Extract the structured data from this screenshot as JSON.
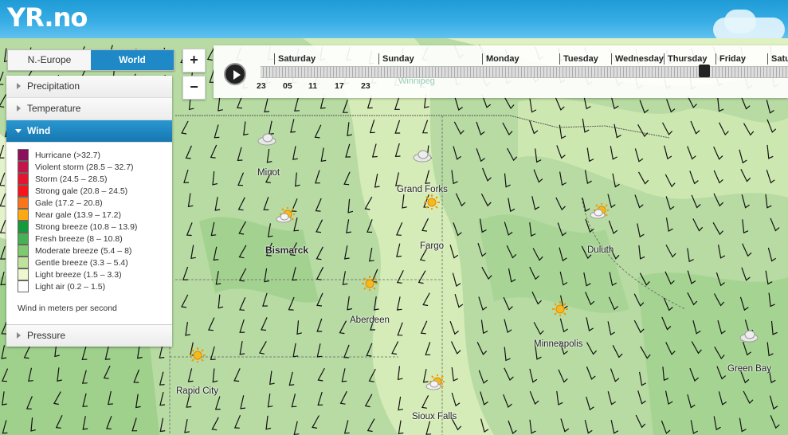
{
  "app": {
    "logo": "YR.no"
  },
  "region_toggle": {
    "left": "N.-Europe",
    "right": "World",
    "active": "World"
  },
  "zoom": {
    "in": "+",
    "out": "−"
  },
  "layers": {
    "precipitation": "Precipitation",
    "temperature": "Temperature",
    "wind": "Wind",
    "pressure": "Pressure"
  },
  "legend": {
    "items": [
      {
        "label": "Hurricane (>32.7)",
        "color": "#8b0f5b"
      },
      {
        "label": "Violent storm (28.5 – 32.7)",
        "color": "#c2154a"
      },
      {
        "label": "Storm (24.5 – 28.5)",
        "color": "#e4162f"
      },
      {
        "label": "Strong gale (20.8 – 24.5)",
        "color": "#f5151c"
      },
      {
        "label": "Gale (17.2 – 20.8)",
        "color": "#f9751c"
      },
      {
        "label": "Near gale (13.9 – 17.2)",
        "color": "#fbaa0f"
      },
      {
        "label": "Strong breeze (10.8 – 13.9)",
        "color": "#139b3b"
      },
      {
        "label": "Fresh breeze (8 – 10.8)",
        "color": "#47b253"
      },
      {
        "label": "Moderate breeze (5.4 – 8)",
        "color": "#7fca6e"
      },
      {
        "label": "Gentle breeze (3.3 – 5.4)",
        "color": "#c0e39c"
      },
      {
        "label": "Light breeze (1.5 – 3.3)",
        "color": "#eef8cf"
      },
      {
        "label": "Light air (0.2 – 1.5)",
        "color": "#ffffff"
      }
    ],
    "unit_note": "Wind in meters per second"
  },
  "timeline": {
    "days": [
      "Saturday",
      "Sunday",
      "Monday",
      "Tuesday",
      "Wednesday",
      "Thursday",
      "Friday",
      "Satu"
    ],
    "hours": [
      "23",
      "05",
      "11",
      "17",
      "23"
    ]
  },
  "map": {
    "background_label": "Winnipeg",
    "cities": [
      {
        "name": "Minot",
        "icon": "cloud-icon",
        "bold": false
      },
      {
        "name": "Grand Forks",
        "icon": "cloud-icon",
        "bold": false
      },
      {
        "name": "Bismarck",
        "icon": "sun-cloud-icon",
        "bold": true
      },
      {
        "name": "Fargo",
        "icon": "sun-icon",
        "bold": false
      },
      {
        "name": "Duluth",
        "icon": "sun-cloud-icon",
        "bold": false
      },
      {
        "name": "Aberdeen",
        "icon": "sun-icon",
        "bold": false
      },
      {
        "name": "Minneapolis",
        "icon": "sun-icon",
        "bold": false
      },
      {
        "name": "Green Bay",
        "icon": "cloud-icon",
        "bold": false
      },
      {
        "name": "Rapid City",
        "icon": "sun-icon",
        "bold": false
      },
      {
        "name": "Sioux Falls",
        "icon": "sun-cloud-icon",
        "bold": false
      }
    ]
  }
}
